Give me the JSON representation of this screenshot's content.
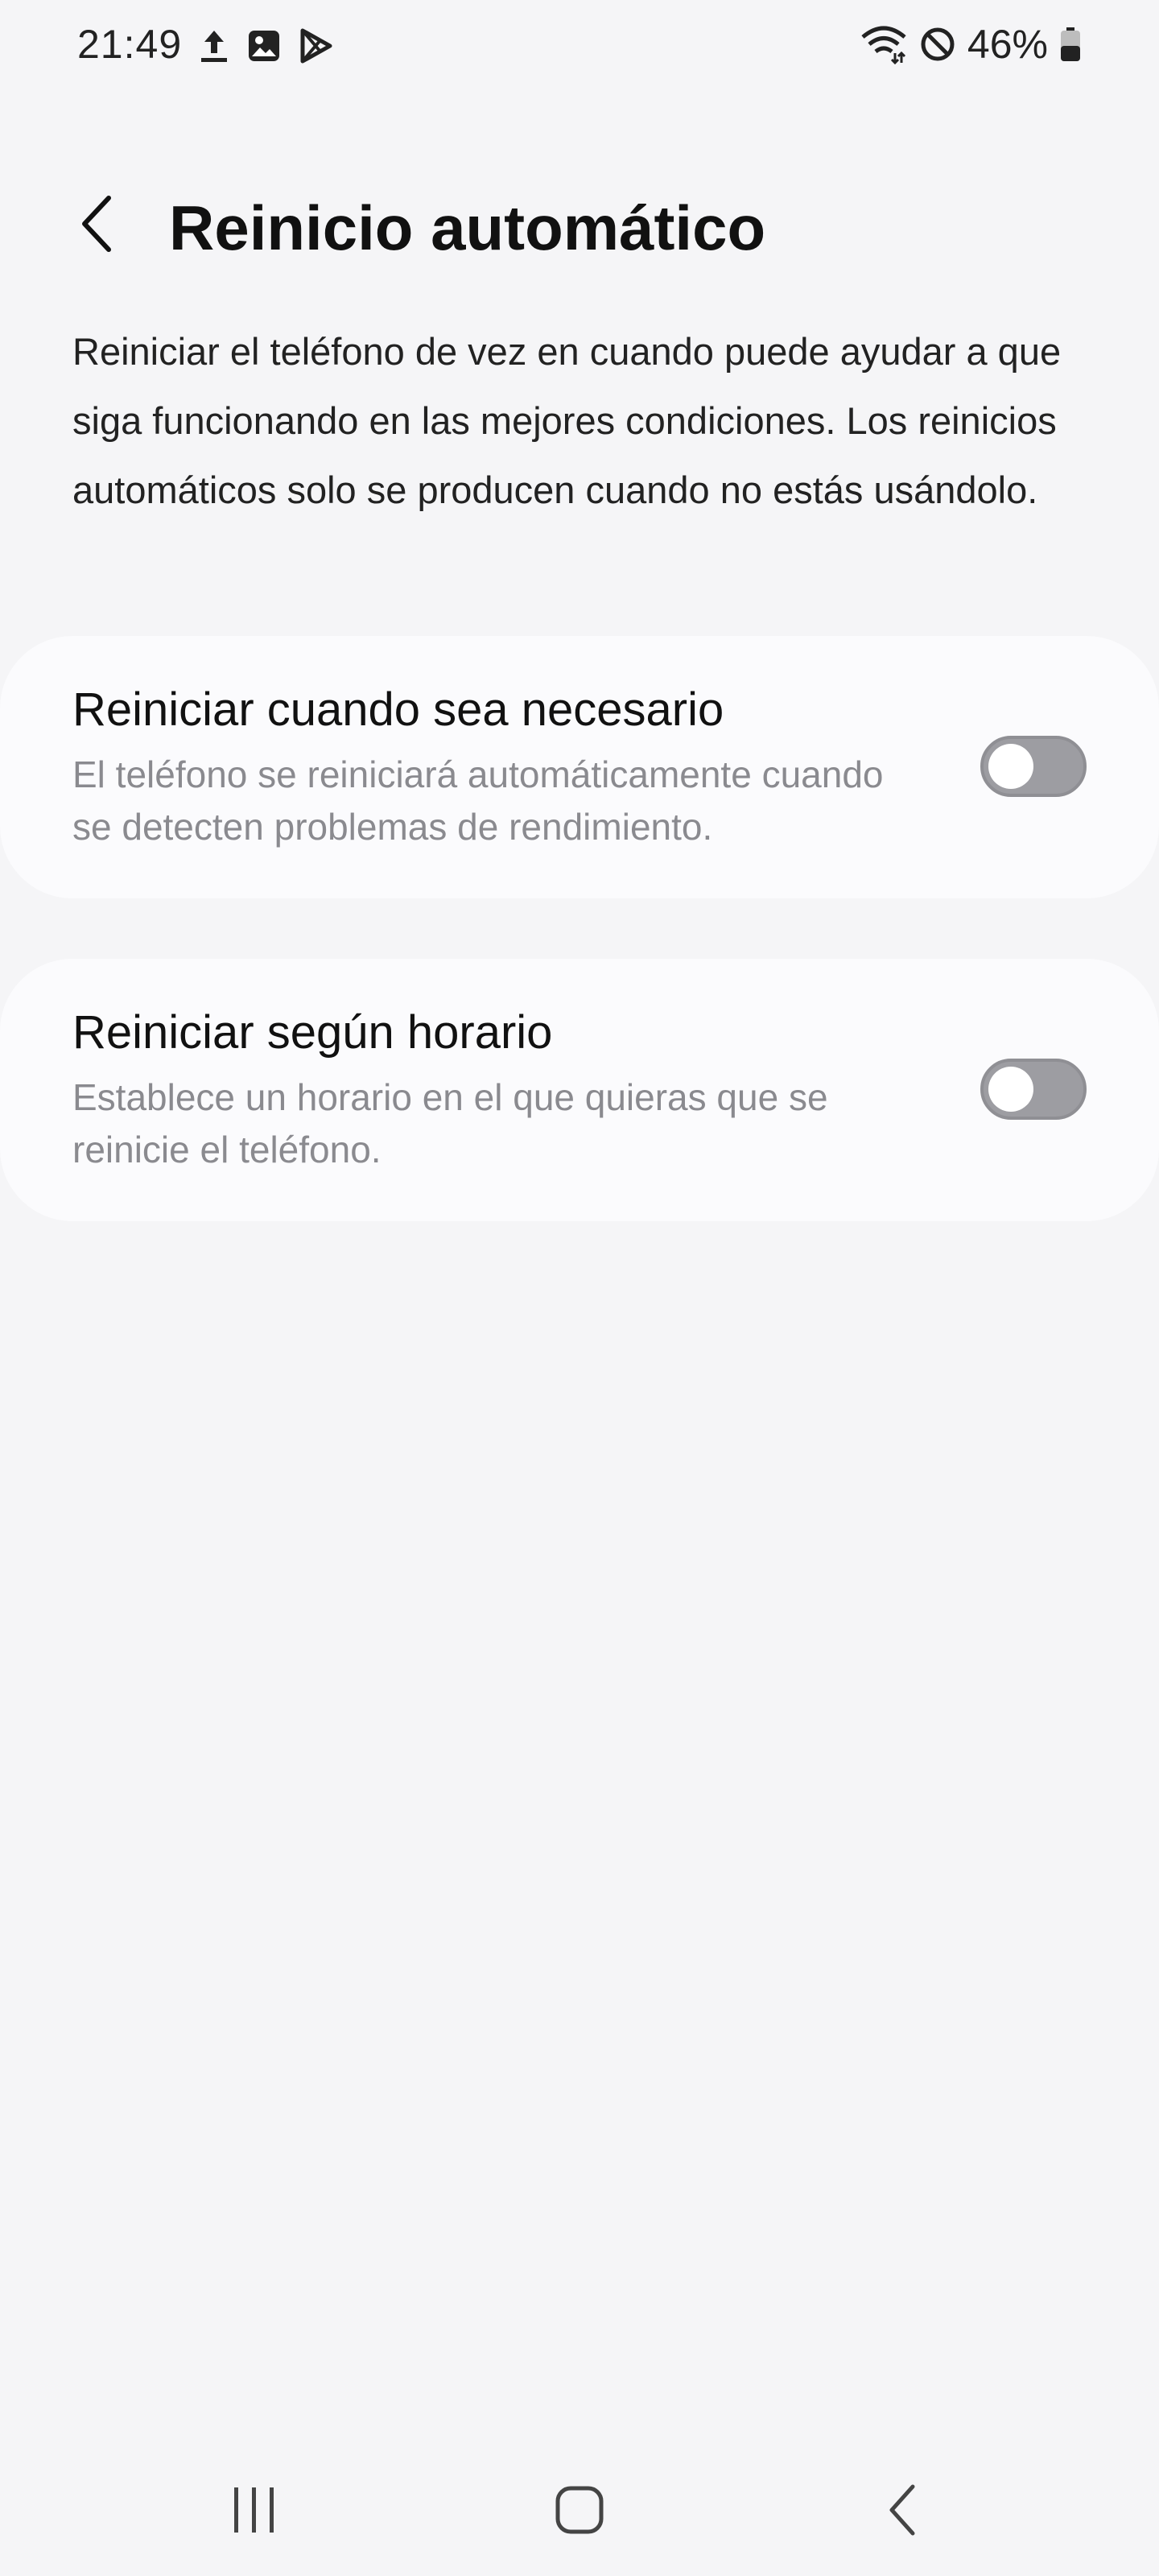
{
  "status_bar": {
    "time": "21:49",
    "battery_text": "46%",
    "left_icons": [
      "upload-icon",
      "image-icon",
      "play-store-icon"
    ],
    "right_icons": [
      "wifi-icon",
      "do-not-disturb-icon",
      "battery-icon"
    ]
  },
  "header": {
    "title": "Reinicio automático",
    "back_icon": "chevron-left-icon"
  },
  "description": "Reiniciar el teléfono de vez en cuando puede ayudar a que siga funcionando en las mejores condiciones. Los reinicios automáticos solo se producen cuando no estás usándolo.",
  "settings": [
    {
      "title": "Reiniciar cuando sea necesario",
      "description": "El teléfono se reiniciará automáticamente cuando se detecten problemas de rendimiento.",
      "enabled": false
    },
    {
      "title": "Reiniciar según horario",
      "description": "Establece un horario en el que quieras que se reinicie el teléfono.",
      "enabled": false
    }
  ],
  "nav_bar": {
    "buttons": [
      "recents-icon",
      "home-icon",
      "back-icon"
    ]
  },
  "colors": {
    "background": "#f5f5f7",
    "card": "#fbfbfd",
    "secondary_text": "#8a8a8f",
    "toggle_off": "#9d9da2"
  }
}
